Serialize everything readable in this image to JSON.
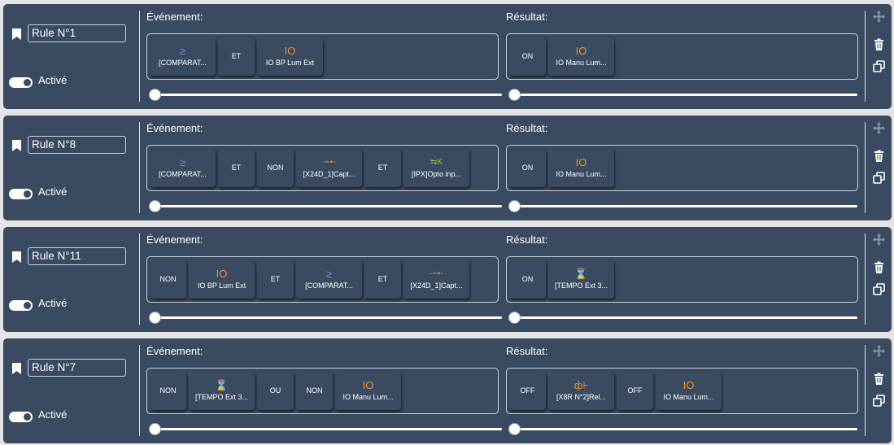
{
  "labels": {
    "event": "Événement:",
    "result": "Résultat:",
    "active": "Activé"
  },
  "colors": {
    "card": "#3a4b61",
    "io_orange": "#f0902c",
    "compare_blue": "#7d86ee",
    "opto_green": "#8cc63f",
    "capteur_orange": "#e2843a",
    "relay_orange": "#f0902c",
    "tempo_orange": "#f0902c"
  },
  "icons": {
    "bookmark": "bookmark-icon",
    "toggle": "toggle-switch",
    "move": "move-icon",
    "delete": "trash-icon",
    "duplicate": "duplicate-icon",
    "compare": "greater-equal-icon",
    "io": "io-icon",
    "capteur": "capteur-icon",
    "opto": "opto-input-icon",
    "tempo": "hourglass-icon",
    "relay": "relay-icon"
  },
  "rules": [
    {
      "name": "Rule N°1",
      "active": true,
      "event_chips": [
        {
          "type": "item",
          "icon": "compare",
          "symbol": "≥",
          "label": "[COMPARAT..."
        },
        {
          "type": "op",
          "label": "ET"
        },
        {
          "type": "item",
          "icon": "io",
          "symbol": "IO",
          "label": "IO BP Lum Ext"
        }
      ],
      "result_chips": [
        {
          "type": "op",
          "label": "ON"
        },
        {
          "type": "item",
          "icon": "io",
          "symbol": "IO",
          "label": "IO Manu Lum..."
        }
      ]
    },
    {
      "name": "Rule N°8",
      "active": true,
      "event_chips": [
        {
          "type": "item",
          "icon": "compare",
          "symbol": "≥",
          "label": "[COMPARAT..."
        },
        {
          "type": "op",
          "label": "ET"
        },
        {
          "type": "op",
          "label": "NON"
        },
        {
          "type": "item",
          "icon": "capteur",
          "symbol": "-⊶-",
          "label": "[X24D_1]Capt..."
        },
        {
          "type": "op",
          "label": "ET"
        },
        {
          "type": "item",
          "icon": "opto",
          "symbol": "⇆K",
          "label": "[IPX]Opto inp..."
        }
      ],
      "result_chips": [
        {
          "type": "op",
          "label": "ON"
        },
        {
          "type": "item",
          "icon": "io",
          "symbol": "IO",
          "label": "IO Manu Lum..."
        }
      ]
    },
    {
      "name": "Rule N°11",
      "active": true,
      "event_chips": [
        {
          "type": "op",
          "label": "NON"
        },
        {
          "type": "item",
          "icon": "io",
          "symbol": "IO",
          "label": "IO BP Lum Ext"
        },
        {
          "type": "op",
          "label": "ET"
        },
        {
          "type": "item",
          "icon": "compare",
          "symbol": "≥",
          "label": "[COMPARAT..."
        },
        {
          "type": "op",
          "label": "ET"
        },
        {
          "type": "item",
          "icon": "capteur",
          "symbol": "-⊶-",
          "label": "[X24D_1]Capt..."
        }
      ],
      "result_chips": [
        {
          "type": "op",
          "label": "ON"
        },
        {
          "type": "item",
          "icon": "tempo",
          "symbol": "⌛",
          "label": "[TEMPO Ext 3..."
        }
      ]
    },
    {
      "name": "Rule N°7",
      "active": true,
      "event_chips": [
        {
          "type": "op",
          "label": "NON"
        },
        {
          "type": "item",
          "icon": "tempo",
          "symbol": "⌛",
          "label": "[TEMPO Ext 3..."
        },
        {
          "type": "op",
          "label": "OU"
        },
        {
          "type": "op",
          "label": "NON"
        },
        {
          "type": "item",
          "icon": "io",
          "symbol": "IO",
          "label": "IO Manu Lum..."
        }
      ],
      "result_chips": [
        {
          "type": "op",
          "label": "OFF"
        },
        {
          "type": "item",
          "icon": "relay",
          "symbol": "ф⊦",
          "label": "[X8R N°2]Rel..."
        },
        {
          "type": "op",
          "label": "OFF"
        },
        {
          "type": "item",
          "icon": "io",
          "symbol": "IO",
          "label": "IO Manu Lum..."
        }
      ]
    }
  ]
}
